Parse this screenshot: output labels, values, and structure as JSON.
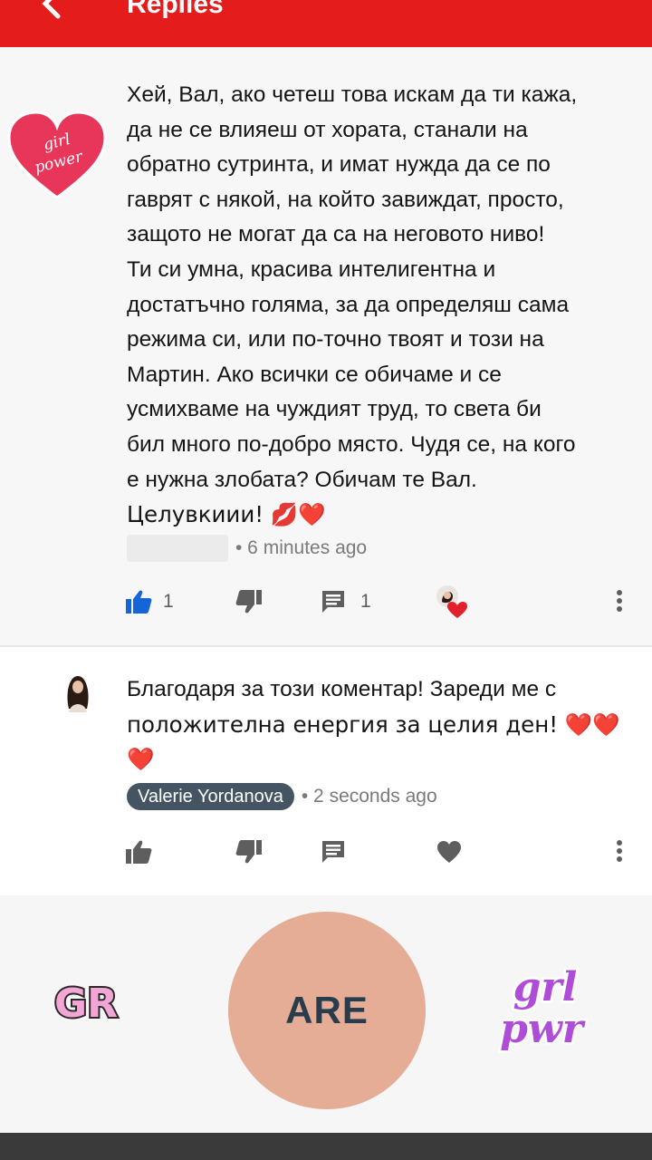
{
  "header": {
    "title": "Replies"
  },
  "comment1": {
    "avatar_text": "girl power",
    "lines": [
      "Хей, Вал, ако четеш това искам да ти кажа,",
      "да не се влияеш от хората, станали на",
      "обратно сутринта, и имат нужда да се по",
      "гаврят с някой, на който завиждат, просто,",
      "защото не могат да са на неговото ниво!",
      "Ти си умна, красива интелигентна и",
      "достатъчно голяма, за да определяш сама",
      "режима си, или по-точно твоят и този на",
      "Мартин. Ако всички се обичаме и се",
      "усмихваме на чуждият труд, то света би",
      "бил много по-добро място. Чудя се, на кого",
      "е нужна злобата? Обичам те Вал.",
      "Целувкиии! 💋❤️"
    ],
    "time": "• 6 minutes ago",
    "likes": "1",
    "replies": "1"
  },
  "comment2": {
    "lines": [
      "Благодаря за този коментар! Зареди ме с",
      "положителна енергия за целия ден! ❤️❤️",
      "❤️"
    ],
    "author": "Valerie Yordanova",
    "time": "• 2 seconds ago"
  },
  "stickers": {
    "left": "GR",
    "center": "ARE",
    "right_line1": "grl",
    "right_line2": "pwr"
  },
  "colors": {
    "header": "#e51c1c",
    "like_active": "#1565d8",
    "author_chip": "#455463",
    "are_circle": "#e5ac96"
  }
}
